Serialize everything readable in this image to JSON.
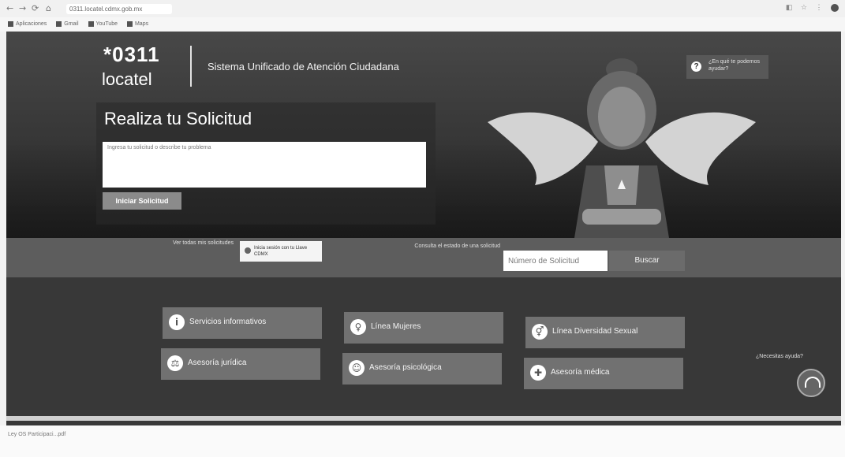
{
  "browser": {
    "url": "0311.locatel.cdmx.gob.mx",
    "bookmarks": [
      "Aplicaciones",
      "Gmail",
      "YouTube",
      "Maps"
    ],
    "status_download": "Ley OS Participaci...pdf"
  },
  "header": {
    "logo_number": "*0311",
    "logo_name": "locatel",
    "system_title": "Sistema Unificado de Atención Ciudadana",
    "help_label": "¿En qué te podemos ayudar?"
  },
  "request": {
    "title": "Realiza tu Solicitud",
    "placeholder": "Ingresa tu solicitud o describe tu problema",
    "start_button": "Iniciar Solicitud"
  },
  "search_strip": {
    "see_all_label": "Ver todas mis solicitudes",
    "badge_text": "Inicia sesión con tu Llave CDMX",
    "consult_label": "Consulta el estado de una solicitud",
    "input_placeholder": "Número de Solicitud",
    "search_button": "Buscar"
  },
  "services": [
    {
      "label": "Servicios informativos",
      "icon": "i"
    },
    {
      "label": "Línea Mujeres",
      "icon": "♀"
    },
    {
      "label": "Línea Diversidad Sexual",
      "icon": "⚥"
    },
    {
      "label": "Asesoría jurídica",
      "icon": "⚖"
    },
    {
      "label": "Asesoría psicológica",
      "icon": "☺"
    },
    {
      "label": "Asesoría médica",
      "icon": "✚"
    }
  ],
  "chat": {
    "label": "¿Necesitas ayuda?"
  },
  "colors": {
    "page_bg": "#3f3f3f",
    "service_button": "#727272",
    "strip": "#5f5f5f"
  }
}
